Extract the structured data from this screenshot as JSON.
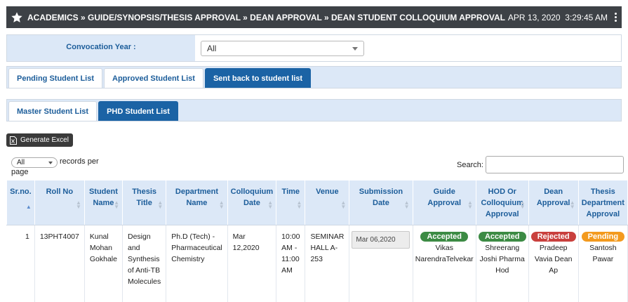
{
  "header": {
    "breadcrumb": "ACADEMICS » GUIDE/SYNOPSIS/THESIS APPROVAL » DEAN APPROVAL » DEAN STUDENT COLLOQUIUM APPROVAL",
    "date": "APR 13, 2020",
    "time": "3:29:45 AM"
  },
  "filter": {
    "label": "Convocation Year :",
    "selected": "All"
  },
  "tabs_row1": [
    {
      "label": "Pending Student List",
      "active": false
    },
    {
      "label": "Approved Student List",
      "active": false
    },
    {
      "label": "Sent back to student list",
      "active": true
    }
  ],
  "tabs_row2": [
    {
      "label": "Master Student List",
      "active": false
    },
    {
      "label": "PHD Student List",
      "active": true
    }
  ],
  "toolbar": {
    "excel_label": "Generate Excel",
    "records_select": "All",
    "records_text": "records per page",
    "search_label": "Search:"
  },
  "table": {
    "columns": [
      "Sr.no.",
      "Roll No",
      "Student Name",
      "Thesis Title",
      "Department Name",
      "Colloquium Date",
      "Time",
      "Venue",
      "Submission Date",
      "Guide Approval",
      "HOD Or Colloquium Approval",
      "Dean Approval",
      "Thesis Department Approval"
    ],
    "rows": [
      {
        "srno": "1",
        "roll": "13PHT4007",
        "name": "Kunal Mohan Gokhale",
        "title": "Design and Synthesis of Anti-TB Molecules",
        "dept": "Ph.D (Tech) - Pharmaceutical Chemistry",
        "colloquium_date": "Mar 12,2020",
        "time": "10:00 AM - 11:00 AM",
        "venue": "SEMINAR HALL A-253",
        "submission_date": "Mar 06,2020",
        "guide": {
          "status": "Accepted",
          "by": "Vikas NarendraTelvekar"
        },
        "hod": {
          "status": "Accepted",
          "by": "Shreerang Joshi Pharma Hod"
        },
        "dean": {
          "status": "Rejected",
          "by": "Pradeep Vavia Dean Ap"
        },
        "thesis": {
          "status": "Pending",
          "by": "Santosh Pawar"
        }
      }
    ]
  },
  "colors": {
    "accepted": "#3c8b44",
    "rejected": "#c9403d",
    "pending": "#f39a1e",
    "header_bar": "#3d4146",
    "active_tab": "#1b63a5",
    "light_blue": "#dce8f7"
  }
}
